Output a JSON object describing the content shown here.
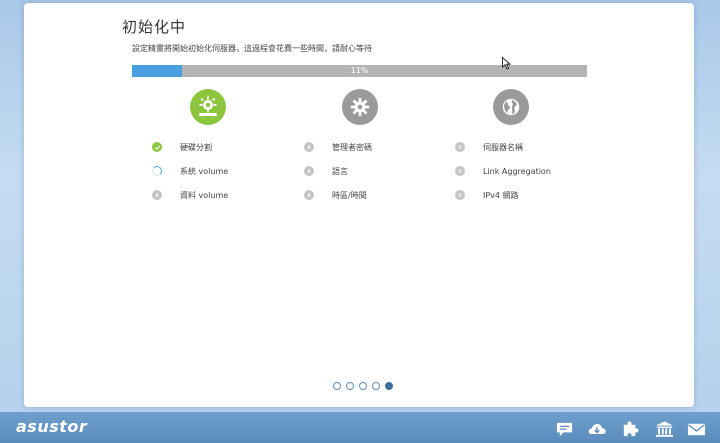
{
  "page": {
    "title": "初始化中",
    "subtitle": "設定精靈將開始初始化伺服器，這過程會花費一些時間，請耐心等待"
  },
  "progress": {
    "value": 0.11,
    "label": "11%"
  },
  "categories": [
    {
      "name": "hardware",
      "icon": "gear-monitor-icon",
      "color": "#8cc63f",
      "steps": [
        {
          "label": "硬碟分割",
          "status": "done"
        },
        {
          "label": "系統 volume",
          "status": "in-progress"
        },
        {
          "label": "資料 volume",
          "status": "pending"
        }
      ]
    },
    {
      "name": "settings",
      "icon": "gear-icon",
      "color": "#9a9a9a",
      "steps": [
        {
          "label": "管理者密碼",
          "status": "pending"
        },
        {
          "label": "語言",
          "status": "pending"
        },
        {
          "label": "時區/時間",
          "status": "pending"
        }
      ]
    },
    {
      "name": "network",
      "icon": "globe-icon",
      "color": "#9a9a9a",
      "steps": [
        {
          "label": "伺服器名稱",
          "status": "pending"
        },
        {
          "label": "Link Aggregation",
          "status": "pending"
        },
        {
          "label": "IPv4 網路",
          "status": "pending"
        }
      ]
    }
  ],
  "pager": {
    "total": 5,
    "active": 5
  },
  "footer": {
    "logo": "asustor",
    "icons": [
      "chat-icon",
      "cloud-download-icon",
      "puzzle-icon",
      "library-icon",
      "mail-icon"
    ]
  }
}
